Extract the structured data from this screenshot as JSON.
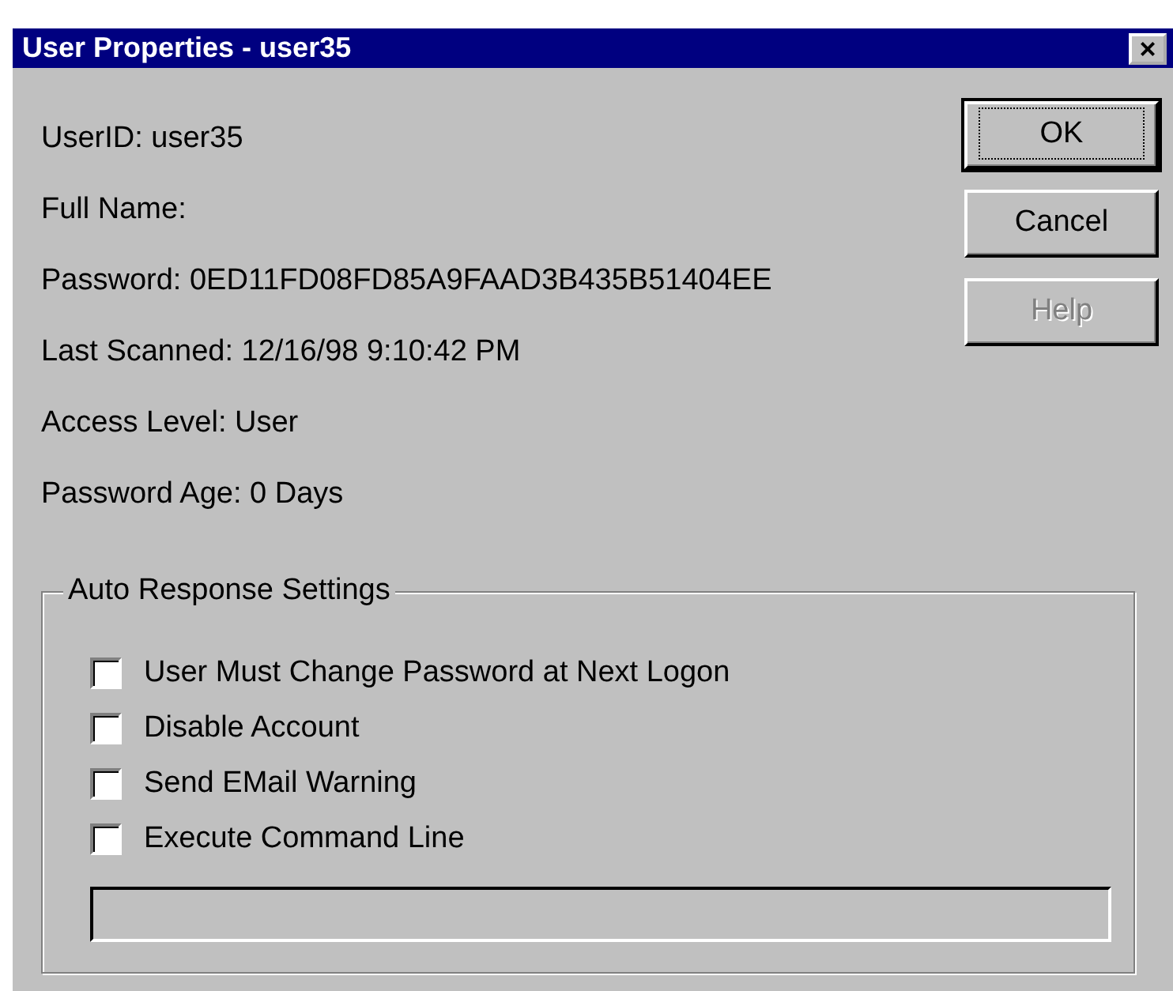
{
  "window": {
    "title": "User Properties - user35",
    "close": "×"
  },
  "fields": [
    {
      "text": "UserID: user35"
    },
    {
      "text": "Full Name:"
    },
    {
      "text": "Password: 0ED11FD08FD85A9FAAD3B435B51404EE"
    },
    {
      "text": "Last Scanned: 12/16/98 9:10:42 PM"
    },
    {
      "text": "Access Level: User"
    },
    {
      "text": "Password Age: 0 Days"
    }
  ],
  "buttons": [
    {
      "label": "OK",
      "default": true,
      "disabled": false
    },
    {
      "label": "Cancel",
      "default": false,
      "disabled": false
    },
    {
      "label": "Help",
      "default": false,
      "disabled": true
    }
  ],
  "group": {
    "title": "Auto Response Settings",
    "options": [
      {
        "label": "User Must Change Password at Next Logon",
        "checked": false
      },
      {
        "label": "Disable Account",
        "checked": false
      },
      {
        "label": "Send EMail Warning",
        "checked": false
      },
      {
        "label": "Execute Command Line",
        "checked": false
      }
    ],
    "command_field": {
      "disabled": true
    }
  }
}
